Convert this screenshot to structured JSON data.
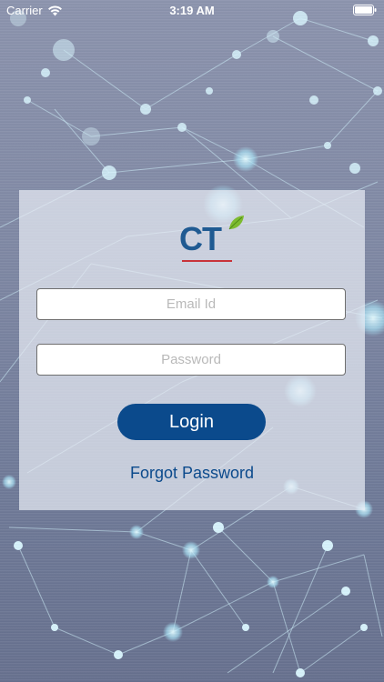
{
  "status_bar": {
    "carrier": "Carrier",
    "time": "3:19 AM"
  },
  "logo": {
    "text": "CT",
    "icon": "leaf-icon",
    "underline_color": "#c8333a",
    "text_color": "#1f5a92"
  },
  "login_form": {
    "email_placeholder": "Email Id",
    "password_placeholder": "Password",
    "login_label": "Login",
    "forgot_label": "Forgot Password"
  },
  "colors": {
    "accent": "#0b4a8c",
    "background": "#7f88a4",
    "network_nodes": "#bfe6f5"
  }
}
